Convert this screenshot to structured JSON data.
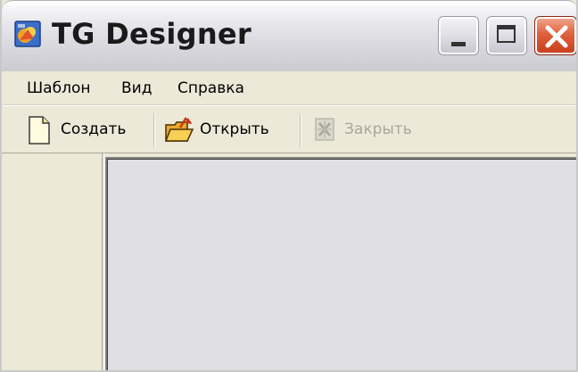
{
  "window": {
    "title": "TG Designer"
  },
  "menu": {
    "items": [
      {
        "label": "Шаблон"
      },
      {
        "label": "Вид"
      },
      {
        "label": "Справка"
      }
    ]
  },
  "toolbar": {
    "buttons": [
      {
        "label": "Создать",
        "icon": "new-document-icon",
        "enabled": true
      },
      {
        "label": "Открыть",
        "icon": "open-folder-icon",
        "enabled": true
      },
      {
        "label": "Закрыть",
        "icon": "close-document-icon",
        "enabled": false
      }
    ]
  },
  "colors": {
    "window_bg": "#ece9d8",
    "workspace_bg": "#e0dfe3",
    "close_button": "#e0603c",
    "disabled_text": "#a8a79a"
  }
}
